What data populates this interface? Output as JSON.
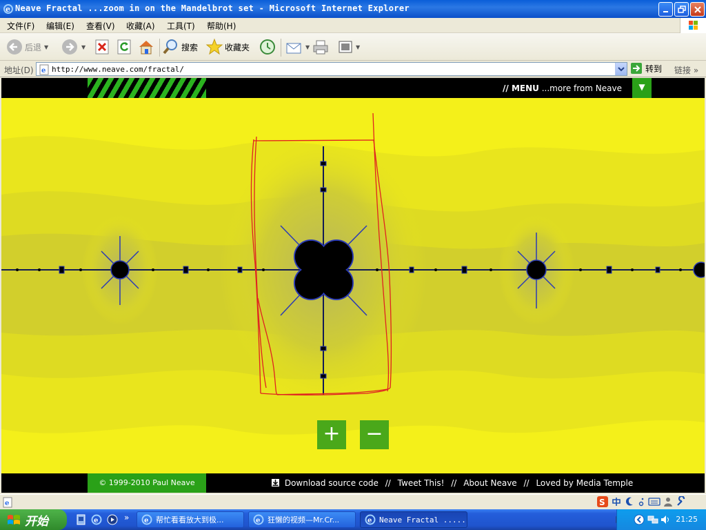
{
  "window": {
    "title": "Neave Fractal ...zoom in on the Mandelbrot set - Microsoft Internet Explorer"
  },
  "menubar": {
    "items": [
      "文件(F)",
      "编辑(E)",
      "查看(V)",
      "收藏(A)",
      "工具(T)",
      "帮助(H)"
    ]
  },
  "toolbar": {
    "back_label": "后退",
    "search_label": "搜索",
    "favorites_label": "收藏夹"
  },
  "address": {
    "label": "地址(D)",
    "url": "http://www.neave.com/fractal/",
    "go_label": "转到",
    "links_label": "链接"
  },
  "page": {
    "menu_prefix": "// MENU",
    "menu_suffix": " ...more from Neave",
    "menu_toggle": "▼",
    "zoom_in": "+",
    "zoom_out": "−",
    "copyright": "© 1999-2010 Paul Neave",
    "footer_links": [
      "Download source code",
      "//",
      "Tweet This!",
      "//",
      "About Neave",
      "//",
      "Loved by Media Temple"
    ]
  },
  "taskbar": {
    "start_label": "开始",
    "tasks": [
      {
        "label": "帮忙看看放大到极..."
      },
      {
        "label": "狂懒的视频—Mr.Cr..."
      },
      {
        "label": "Neave Fractal ....."
      }
    ],
    "clock": "21:25"
  },
  "colors": {
    "fractal_bg": "#f2ee1a",
    "brand_green": "#2aa118",
    "annotation_red": "#e02020"
  }
}
